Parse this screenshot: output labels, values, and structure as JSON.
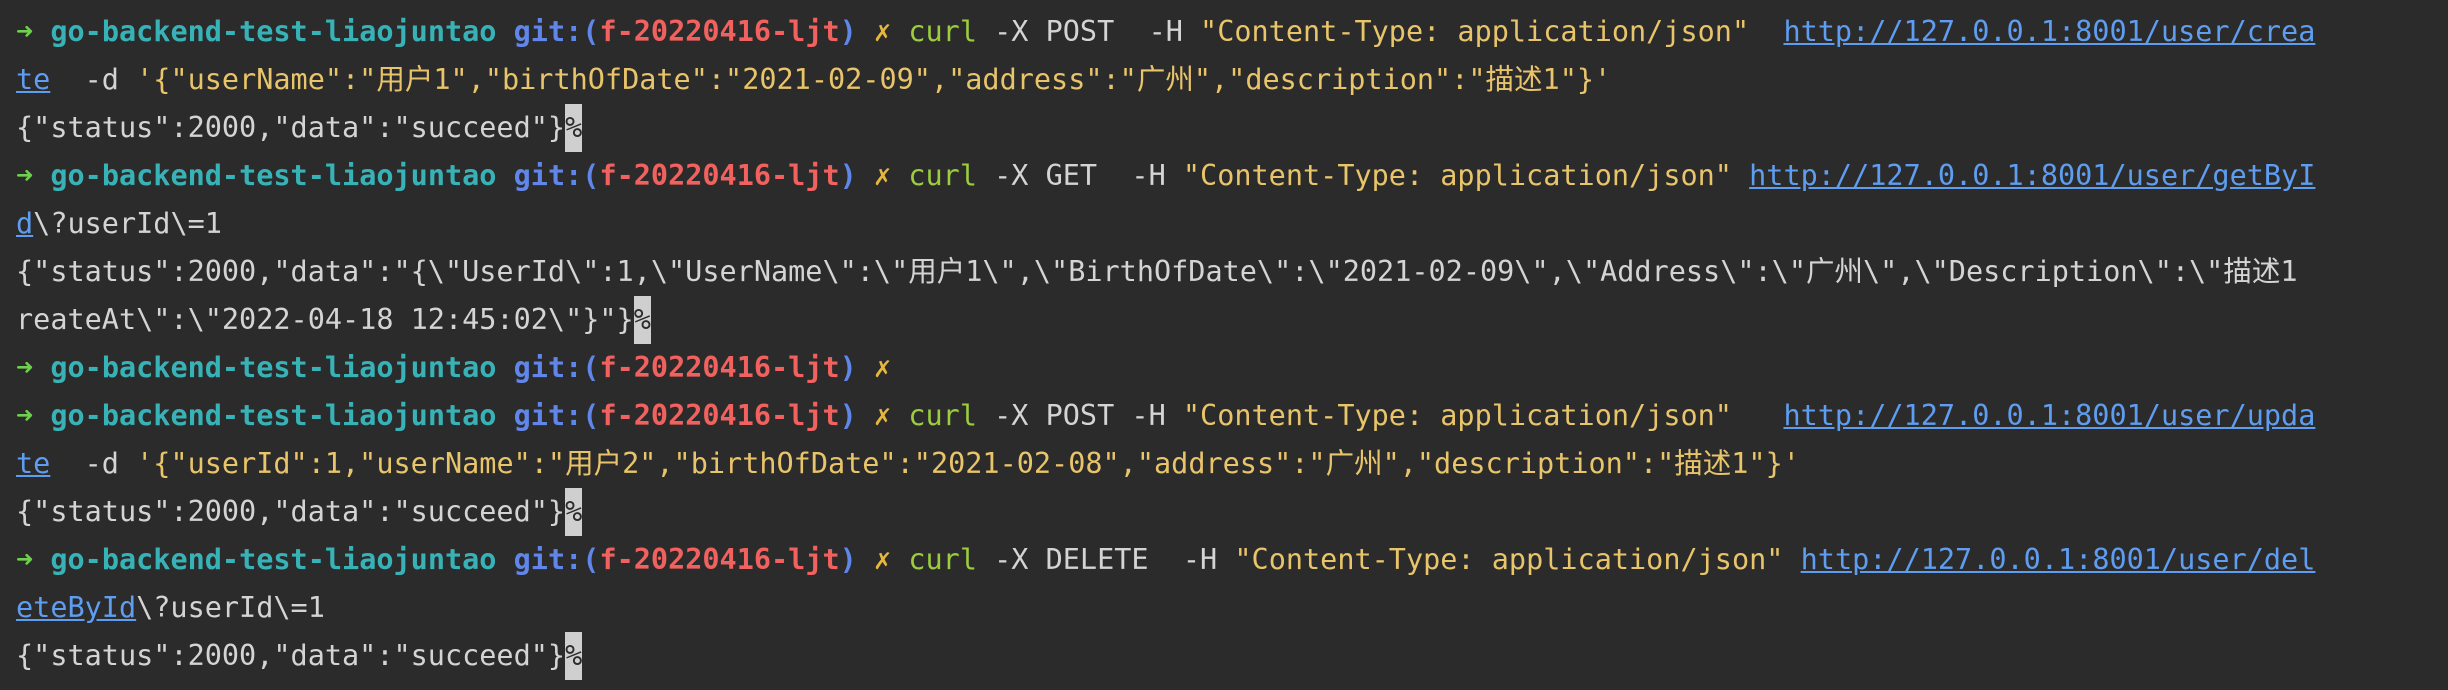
{
  "prompt": {
    "arrow": "➜",
    "directory": "go-backend-test-liaojuntao",
    "git_label": "git:(",
    "branch": "f-20220416-ljt",
    "git_close": ")",
    "dirty_mark": "✗"
  },
  "lines": [
    {
      "prompt": true,
      "cmd": "curl",
      "args": " -X POST  -H ",
      "header": "\"Content-Type: application/json\"",
      "gap": "  ",
      "url": "http://127.0.0.1:8001/user/crea"
    },
    {
      "url_cont": "te",
      "rest": "  -d ",
      "body": "'{\"userName\":\"用户1\",\"birthOfDate\":\"2021-02-09\",\"address\":\"广州\",\"description\":\"描述1\"}'"
    },
    {
      "output": "{\"status\":2000,\"data\":\"succeed\"}",
      "mark": "%"
    },
    {
      "prompt": true,
      "cmd": "curl",
      "args": " -X GET  -H ",
      "header": "\"Content-Type: application/json\"",
      "gap": " ",
      "url": "http://127.0.0.1:8001/user/getByI"
    },
    {
      "url_cont": "d",
      "rest": "\\?userId\\=1"
    },
    {
      "output": "{\"status\":2000,\"data\":\"{\\\"UserId\\\":1,\\\"UserName\\\":\\\"用户1\\\",\\\"BirthOfDate\\\":\\\"2021-02-09\\\",\\\"Address\\\":\\\"广州\\\",\\\"Description\\\":\\\"描述1"
    },
    {
      "output": "reateAt\\\":\\\"2022-04-18 12:45:02\\\"}\"}",
      "mark": "%"
    },
    {
      "prompt": true
    },
    {
      "prompt": true,
      "cmd": "curl",
      "args": " -X POST -H ",
      "header": "\"Content-Type: application/json\"",
      "gap": "   ",
      "url": "http://127.0.0.1:8001/user/upda"
    },
    {
      "url_cont": "te",
      "rest": "  -d ",
      "body": "'{\"userId\":1,\"userName\":\"用户2\",\"birthOfDate\":\"2021-02-08\",\"address\":\"广州\",\"description\":\"描述1\"}'"
    },
    {
      "output": "{\"status\":2000,\"data\":\"succeed\"}",
      "mark": "%"
    },
    {
      "prompt": true,
      "cmd": "curl",
      "args": " -X DELETE  -H ",
      "header": "\"Content-Type: application/json\"",
      "gap": " ",
      "url": "http://127.0.0.1:8001/user/del"
    },
    {
      "url_cont": "eteById",
      "rest": "\\?userId\\=1"
    },
    {
      "output": "{\"status\":2000,\"data\":\"succeed\"}",
      "mark": "%"
    }
  ]
}
